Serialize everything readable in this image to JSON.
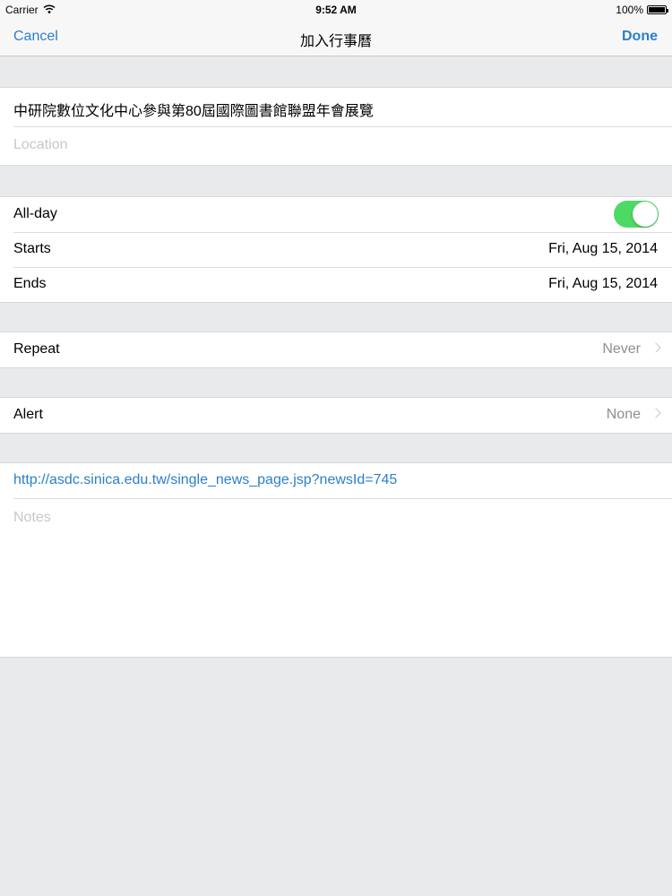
{
  "status_bar": {
    "carrier": "Carrier",
    "time": "9:52 AM",
    "battery": "100%"
  },
  "nav": {
    "cancel": "Cancel",
    "title": "加入行事曆",
    "done": "Done"
  },
  "event": {
    "title": "中研院數位文化中心參與第80屆國際圖書館聯盟年會展覽",
    "location_placeholder": "Location"
  },
  "dates": {
    "all_day_label": "All-day",
    "all_day_on": true,
    "starts_label": "Starts",
    "starts_value": "Fri, Aug 15, 2014",
    "ends_label": "Ends",
    "ends_value": "Fri, Aug 15, 2014"
  },
  "repeat": {
    "label": "Repeat",
    "value": "Never"
  },
  "alert": {
    "label": "Alert",
    "value": "None"
  },
  "notes": {
    "url": "http://asdc.sinica.edu.tw/single_news_page.jsp?newsId=745",
    "placeholder": "Notes"
  },
  "colors": {
    "accent": "#2b7fcb",
    "toggle_on": "#4cd964",
    "background": "#e9eaec"
  }
}
